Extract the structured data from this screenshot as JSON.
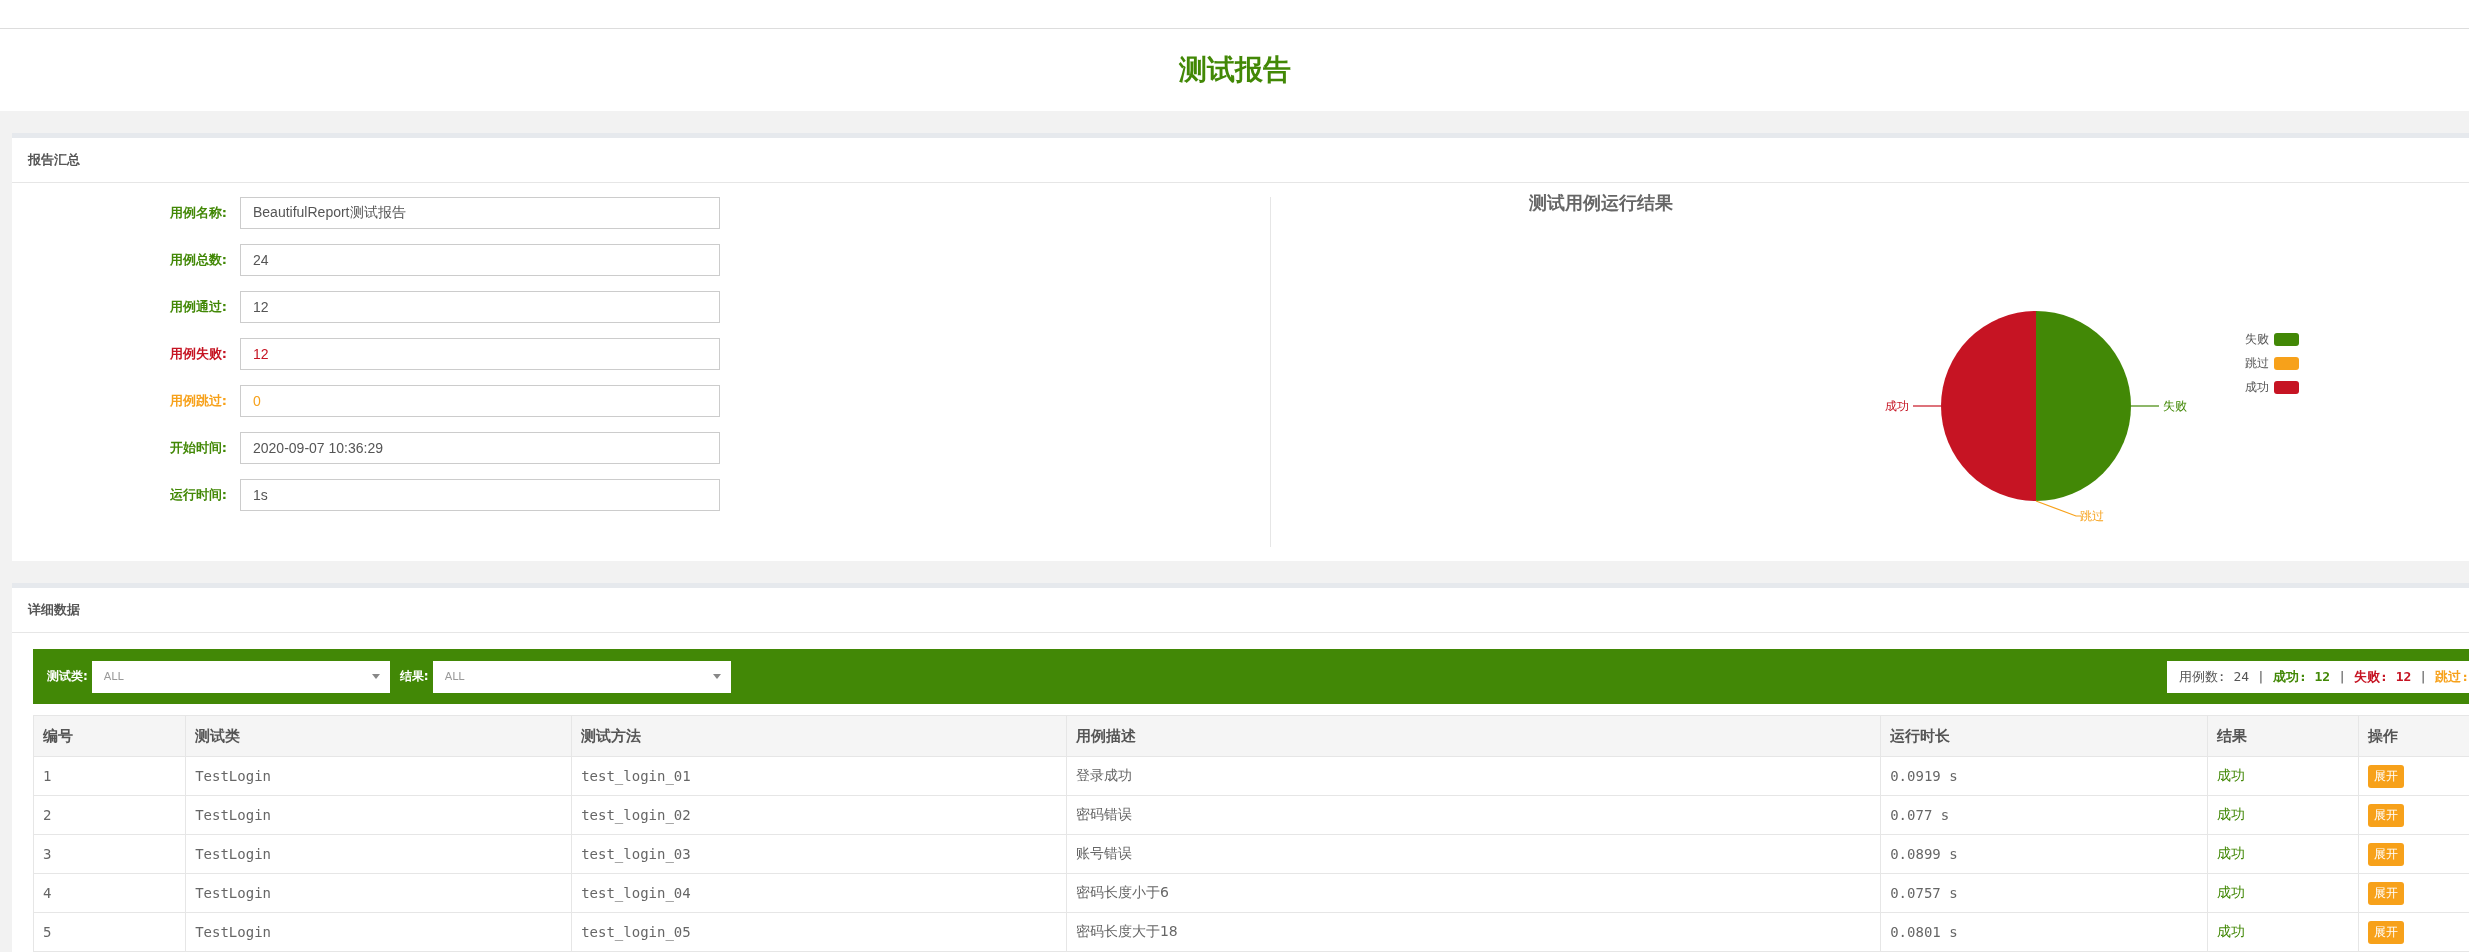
{
  "header": {
    "title": "测试报告"
  },
  "summary": {
    "title": "报告汇总",
    "fields": [
      {
        "label": "用例名称:",
        "value": "BeautifulReport测试报告",
        "kind": "normal"
      },
      {
        "label": "用例总数:",
        "value": "24",
        "kind": "normal"
      },
      {
        "label": "用例通过:",
        "value": "12",
        "kind": "normal"
      },
      {
        "label": "用例失败:",
        "value": "12",
        "kind": "fail"
      },
      {
        "label": "用例跳过:",
        "value": "0",
        "kind": "skip"
      },
      {
        "label": "开始时间:",
        "value": "2020-09-07 10:36:29",
        "kind": "normal"
      },
      {
        "label": "运行时间:",
        "value": "1s",
        "kind": "normal"
      }
    ],
    "chart_data": {
      "type": "pie",
      "title": "测试用例运行结果",
      "categories": [
        "失败",
        "跳过",
        "成功"
      ],
      "values": [
        50,
        0,
        50
      ],
      "legend": true,
      "colors": [
        "#428806",
        "#f7a11a",
        "#c61423"
      ]
    }
  },
  "details": {
    "title": "详细数据",
    "filters": [
      {
        "label": "测试类:",
        "value": "ALL"
      },
      {
        "label": "结果:",
        "value": "ALL"
      }
    ],
    "separator": "|",
    "counts": [
      {
        "label": "用例数:",
        "value": "24",
        "kind": "total"
      },
      {
        "label": "成功:",
        "value": "12",
        "kind": "pass"
      },
      {
        "label": "失败:",
        "value": "12",
        "kind": "fail"
      },
      {
        "label": "跳过:",
        "kind": "skip"
      }
    ],
    "table": {
      "columns": [
        "编号",
        "测试类",
        "测试方法",
        "用例描述",
        "运行时长",
        "结果",
        "操作"
      ],
      "rows": [
        {
          "id": "1",
          "class": "TestLogin",
          "method": "test_login_01",
          "desc": "登录成功",
          "time": "0.0919 s",
          "result": "成功",
          "action": "展开"
        },
        {
          "id": "2",
          "class": "TestLogin",
          "method": "test_login_02",
          "desc": "密码错误",
          "time": "0.077 s",
          "result": "成功",
          "action": "展开"
        },
        {
          "id": "3",
          "class": "TestLogin",
          "method": "test_login_03",
          "desc": "账号错误",
          "time": "0.0899 s",
          "result": "成功",
          "action": "展开"
        },
        {
          "id": "4",
          "class": "TestLogin",
          "method": "test_login_04",
          "desc": "密码长度小于6",
          "time": "0.0757 s",
          "result": "成功",
          "action": "展开"
        },
        {
          "id": "5",
          "class": "TestLogin",
          "method": "test_login_05",
          "desc": "密码长度大于18",
          "time": "0.0801 s",
          "result": "成功",
          "action": "展开"
        }
      ]
    }
  }
}
